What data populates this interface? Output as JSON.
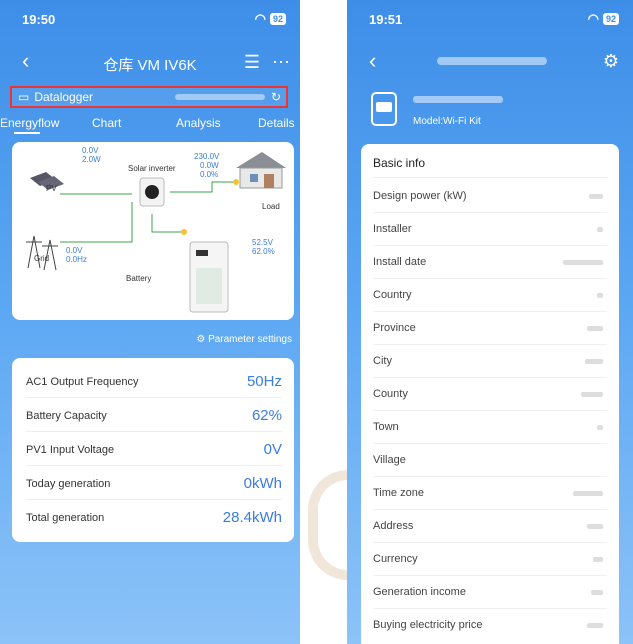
{
  "left": {
    "status": {
      "time": "19:50",
      "battery": "92"
    },
    "nav": {
      "back": "‹",
      "title": "仓库 VM IV6K"
    },
    "datalogger": {
      "label": "Datalogger"
    },
    "tabs": [
      "Energyflow",
      "Chart",
      "Analysis",
      "Details"
    ],
    "flow": {
      "pv": {
        "label": "PV",
        "v1": "0.0V",
        "v2": "2.0W"
      },
      "inverter": {
        "label": "Solar inverter"
      },
      "load": {
        "label": "Load",
        "v1": "230.0V",
        "v2": "0.0W",
        "v3": "0.0%"
      },
      "grid": {
        "label": "Grid",
        "v1": "0.0V",
        "v2": "0.0Hz"
      },
      "battery": {
        "label": "Battery",
        "v1": "52.5V",
        "v2": "62.0%"
      }
    },
    "param_settings": "Parameter settings",
    "metrics": [
      {
        "label": "AC1 Output Frequency",
        "value": "50Hz"
      },
      {
        "label": "Battery Capacity",
        "value": "62%"
      },
      {
        "label": "PV1 Input Voltage",
        "value": "0V"
      },
      {
        "label": "Today generation",
        "value": "0kWh"
      },
      {
        "label": "Total generation",
        "value": "28.4kWh"
      }
    ]
  },
  "right": {
    "status": {
      "time": "19:51",
      "battery": "92"
    },
    "model": "Model:Wi-Fi Kit",
    "info_header": "Basic info",
    "info_rows": [
      "Design power (kW)",
      "Installer",
      "Install date",
      "Country",
      "Province",
      "City",
      "County",
      "Town",
      "Village",
      "Time zone",
      "Address",
      "Currency",
      "Generation  income",
      "Buying electricity price"
    ]
  },
  "colors": {
    "accent": "#3b7ddd",
    "highlight_border": "#e33333"
  }
}
